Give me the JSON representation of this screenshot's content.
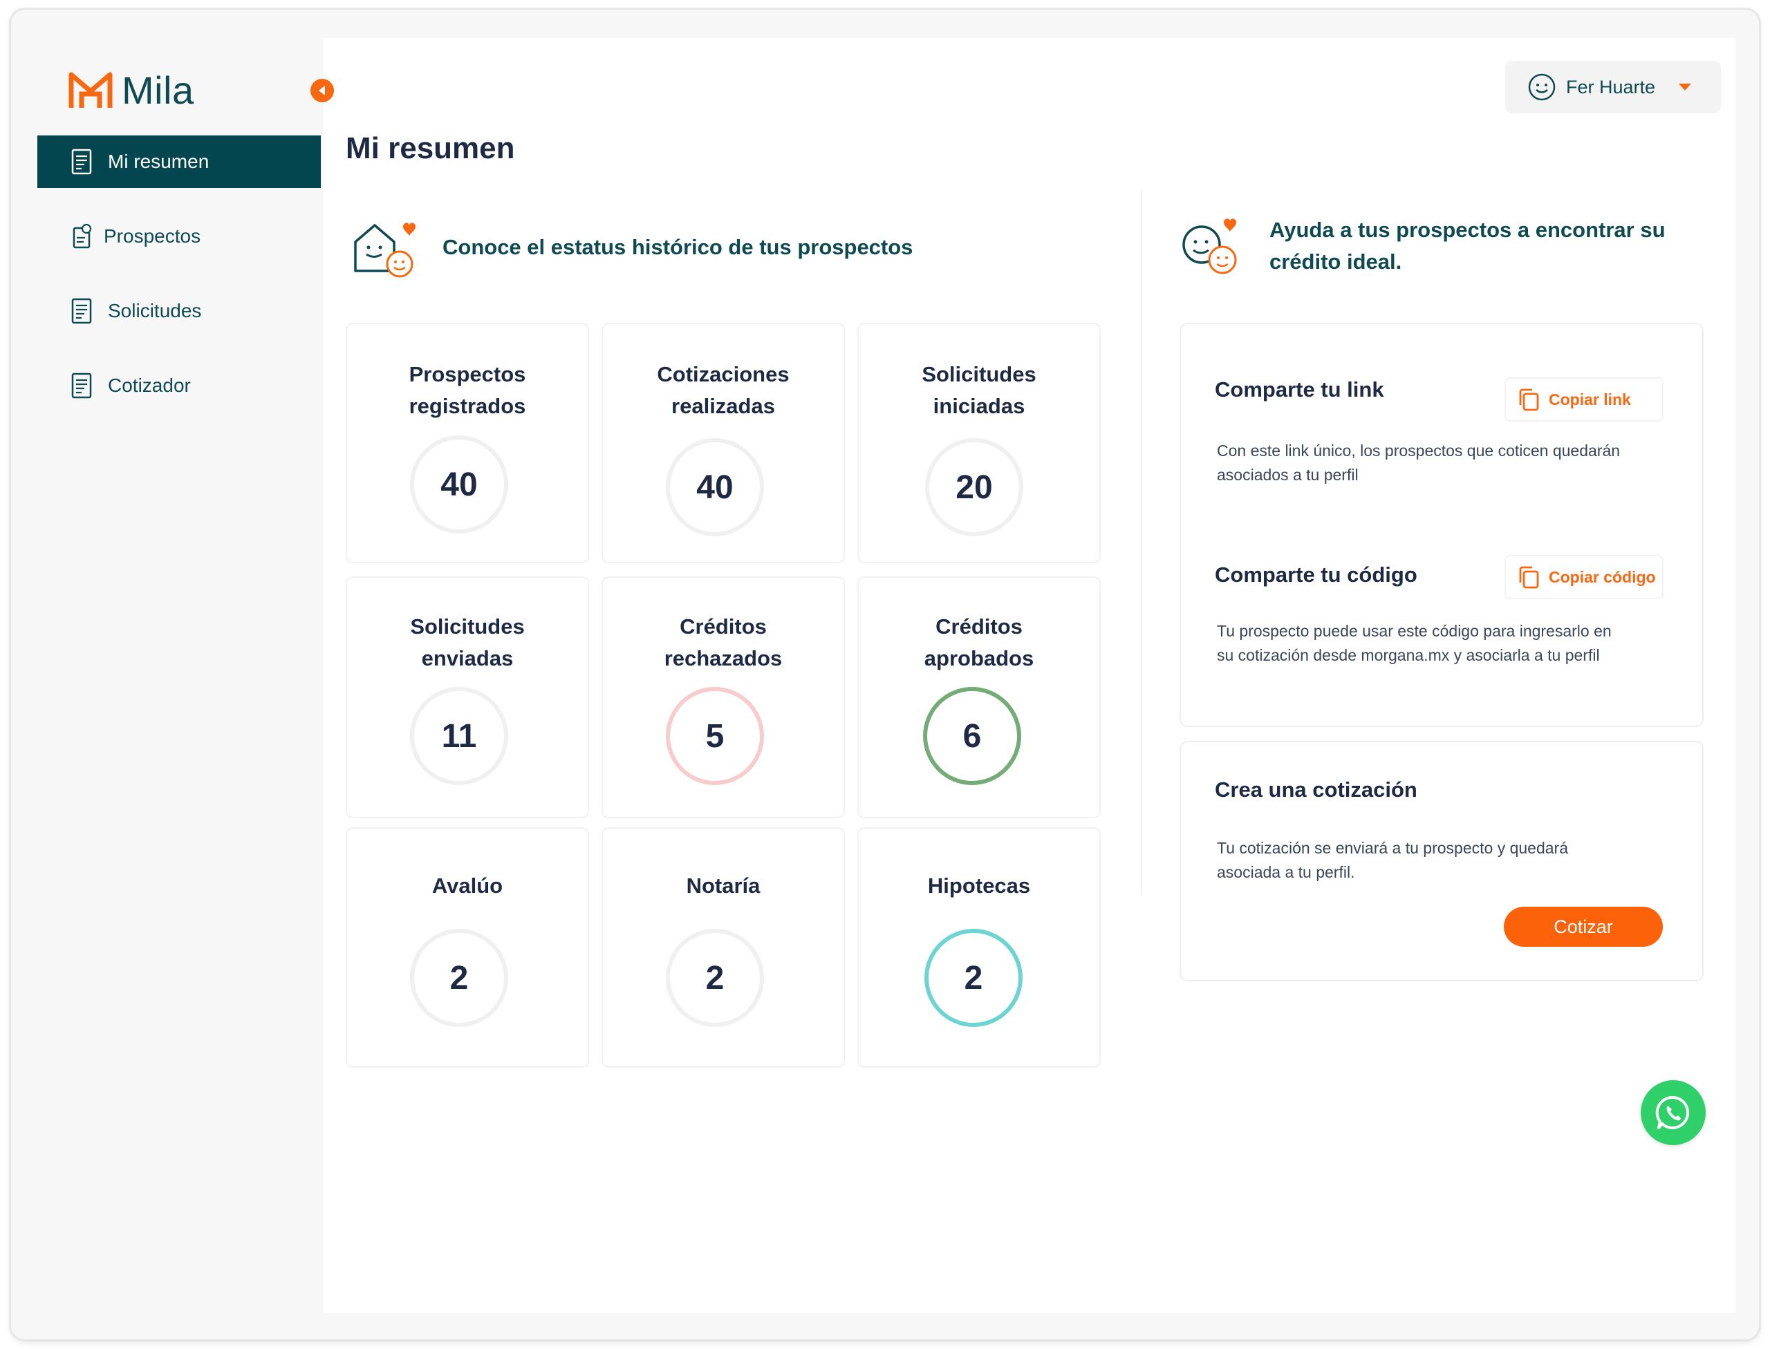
{
  "app": {
    "logo_text": "Mila"
  },
  "sidebar": {
    "items": [
      {
        "label": "Mi resumen",
        "active": true
      },
      {
        "label": "Prospectos",
        "active": false
      },
      {
        "label": "Solicitudes",
        "active": false
      },
      {
        "label": "Cotizador",
        "active": false
      }
    ]
  },
  "user": {
    "name": "Fer Huarte"
  },
  "page": {
    "title": "Mi resumen"
  },
  "stats_section": {
    "title": "Conoce el estatus histórico de tus prospectos"
  },
  "stats": [
    {
      "label": "Prospectos\nregistrados",
      "value": "40",
      "ring_color": "#f0f0f0"
    },
    {
      "label": "Cotizaciones\nrealizadas",
      "value": "40",
      "ring_color": "#f0f0f0"
    },
    {
      "label": "Solicitudes\niniciadas",
      "value": "20",
      "ring_color": "#f0f0f0"
    },
    {
      "label": "Solicitudes\nenviadas",
      "value": "11",
      "ring_color": "#f0f0f0"
    },
    {
      "label": "Créditos\nrechazados",
      "value": "5",
      "ring_color": "#f8cccc"
    },
    {
      "label": "Créditos\naprobados",
      "value": "6",
      "ring_color": "#74ab77"
    },
    {
      "label": "Avalúo",
      "value": "2",
      "ring_color": "#f0f0f0"
    },
    {
      "label": "Notaría",
      "value": "2",
      "ring_color": "#f0f0f0"
    },
    {
      "label": "Hipotecas",
      "value": "2",
      "ring_color": "#6dd4d4"
    }
  ],
  "help_section": {
    "title_line1": "Ayuda a tus prospectos a encontrar su",
    "title_line2": "crédito ideal."
  },
  "share_link": {
    "title": "Comparte tu link",
    "button": "Copiar link",
    "text_line1": "Con este link único, los prospectos que coticen quedarán",
    "text_line2": "asociados a tu perfil"
  },
  "share_code": {
    "title": "Comparte tu código",
    "button": "Copiar código",
    "text_line1": "Tu prospecto puede usar este código para ingresarlo en",
    "text_line2": "su cotización desde morgana.mx y asociarla a tu perfil"
  },
  "quote": {
    "title": "Crea una cotización",
    "text_line1": "Tu cotización se enviará a tu prospecto y quedará",
    "text_line2": "asociada a tu perfil.",
    "button": "Cotizar"
  },
  "colors": {
    "brand_orange": "#f76810",
    "brand_teal": "#034650",
    "whatsapp_green": "#2fd06a"
  }
}
